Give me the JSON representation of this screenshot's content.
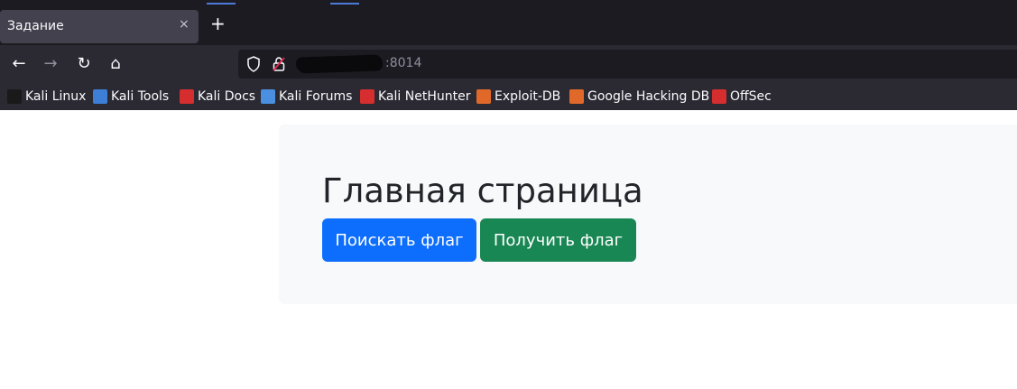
{
  "browser": {
    "tab": {
      "title": "Задание",
      "close": "×"
    },
    "new_tab": "+",
    "nav": {
      "back": "←",
      "forward": "→",
      "reload": "↻",
      "home": "⌂"
    },
    "url": {
      "port_text": ":8014"
    },
    "bookmarks": [
      {
        "label": "Kali Linux",
        "icon": "kali-dragon-icon",
        "color": "#1a1a1a"
      },
      {
        "label": "Kali Tools",
        "icon": "kali-tools-icon",
        "color": "#3d7fd6"
      },
      {
        "label": "Kali Docs",
        "icon": "kali-docs-icon",
        "color": "#d62e2e"
      },
      {
        "label": "Kali Forums",
        "icon": "kali-forums-icon",
        "color": "#4a8fe0"
      },
      {
        "label": "Kali NetHunter",
        "icon": "kali-nethunter-icon",
        "color": "#d62e2e"
      },
      {
        "label": "Exploit-DB",
        "icon": "exploit-db-icon",
        "color": "#e0692a"
      },
      {
        "label": "Google Hacking DB",
        "icon": "ghdb-icon",
        "color": "#e0692a"
      },
      {
        "label": "OffSec",
        "icon": "offsec-icon",
        "color": "#d62e2e"
      }
    ]
  },
  "page": {
    "heading": "Главная страница",
    "buttons": {
      "search_flag": "Поискать флаг",
      "get_flag": "Получить флаг"
    },
    "colors": {
      "primary": "#0d6efd",
      "success": "#198754",
      "card_bg": "#f8f9fa"
    }
  }
}
